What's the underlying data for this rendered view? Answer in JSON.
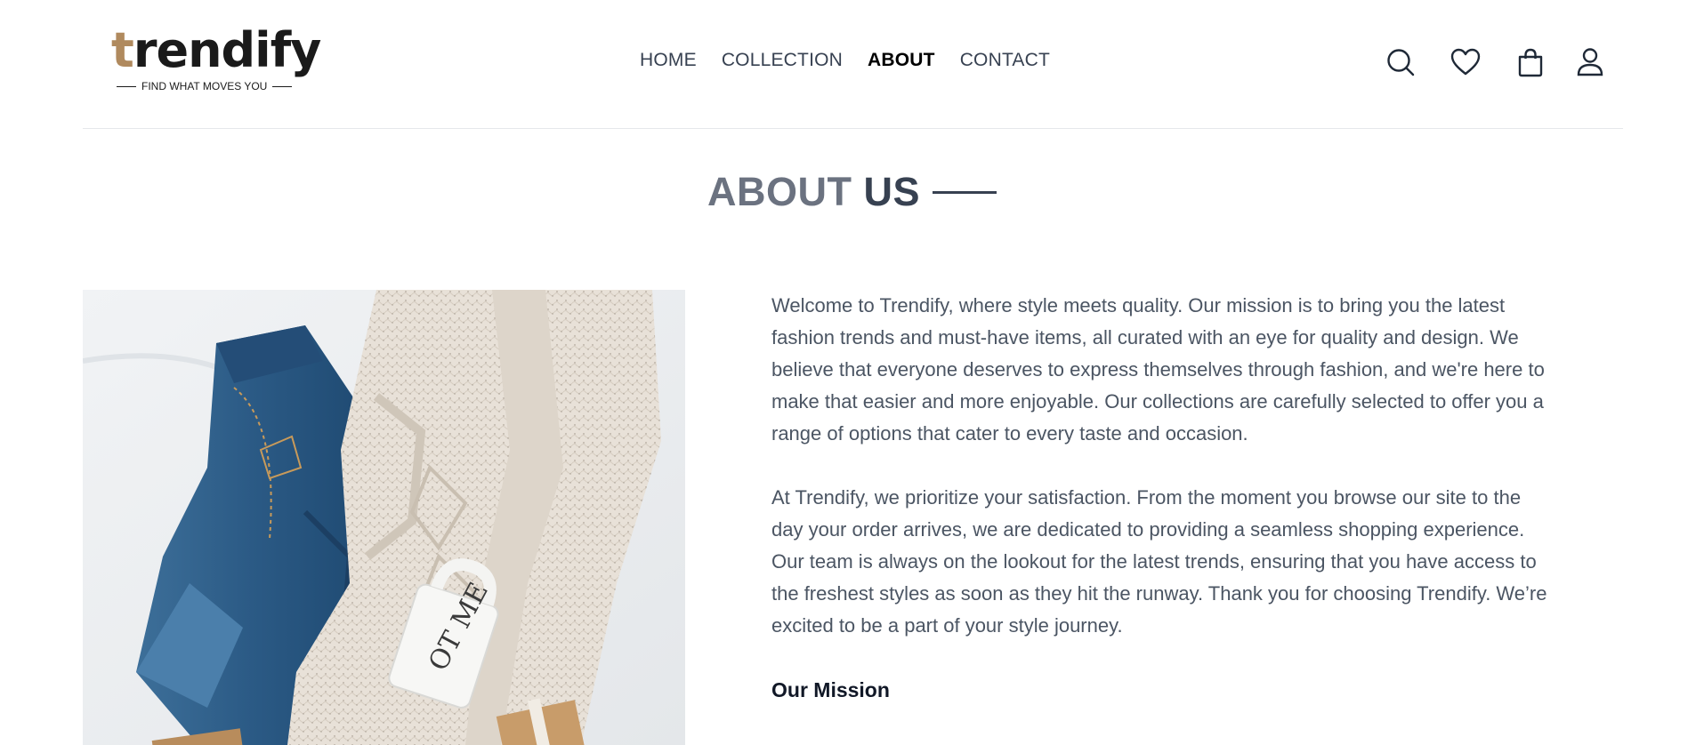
{
  "brand": {
    "name_accent": "t",
    "name_rest": "rendify",
    "tagline": "FIND WHAT MOVES YOU"
  },
  "nav": {
    "items": [
      {
        "label": "HOME",
        "active": false
      },
      {
        "label": "COLLECTION",
        "active": false
      },
      {
        "label": "ABOUT",
        "active": true
      },
      {
        "label": "CONTACT",
        "active": false
      }
    ]
  },
  "header_icons": [
    "search-icon",
    "heart-icon",
    "shopping-bag-icon",
    "user-icon"
  ],
  "page": {
    "title_part1": "ABOUT",
    "title_part2": "US"
  },
  "about": {
    "paragraphs": [
      "Welcome to Trendify, where style meets quality. Our mission is to bring you the latest fashion trends and must-have items, all curated with an eye for quality and design. We believe that everyone deserves to express themselves through fashion, and we're here to make that easier and more enjoyable. Our collections are carefully selected to offer you a range of options that cater to every taste and occasion.",
      "At Trendify, we prioritize your satisfaction. From the moment you browse our site to the day your order arrives, we are dedicated to providing a seamless shopping experience. Our team is always on the lookout for the latest trends, ensuring that you have access to the freshest styles as soon as they hit the runway. Thank you for choosing Trendify. We’re excited to be a part of your style journey."
    ],
    "mission_heading": "Our Mission",
    "mug_text": "OT ME"
  },
  "colors": {
    "accent": "#b08a5e",
    "text_dark": "#374151",
    "text_muted": "#6b7280",
    "denim": "#2f5f8a",
    "sweater": "#e6dfd6"
  }
}
